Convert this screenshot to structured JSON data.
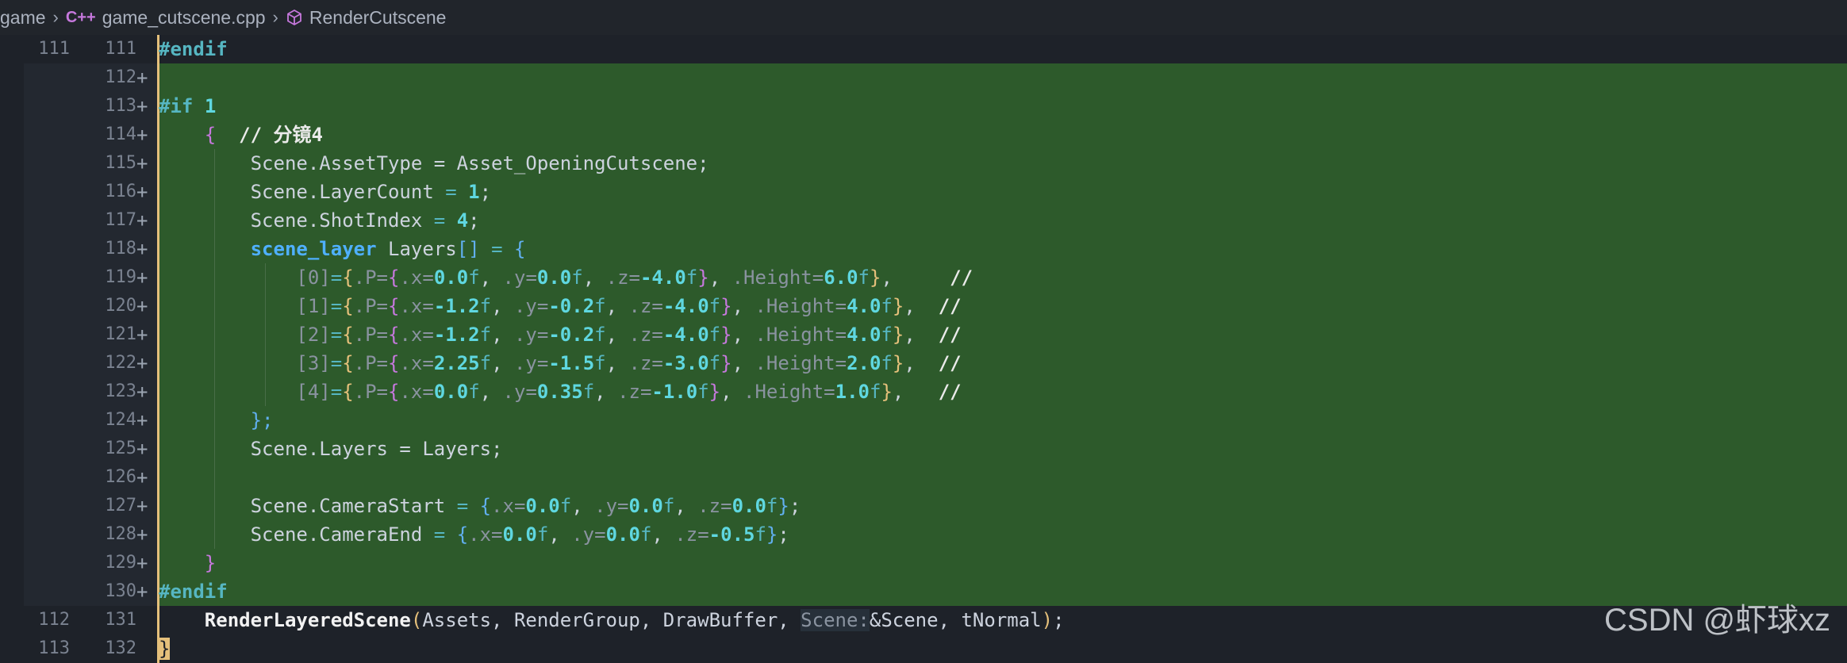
{
  "breadcrumb": {
    "folder": "game",
    "file": "game_cutscene.cpp",
    "symbol": "RenderCutscene",
    "file_icon_glyph": "C++"
  },
  "lines": {
    "l111": {
      "old": "111",
      "new": "111"
    },
    "l112": {
      "new": "112"
    },
    "l113": {
      "new": "113"
    },
    "l114": {
      "new": "114"
    },
    "l115": {
      "new": "115"
    },
    "l116": {
      "new": "116"
    },
    "l117": {
      "new": "117"
    },
    "l118": {
      "new": "118"
    },
    "l119": {
      "new": "119"
    },
    "l120": {
      "new": "120"
    },
    "l121": {
      "new": "121"
    },
    "l122": {
      "new": "122"
    },
    "l123": {
      "new": "123"
    },
    "l124": {
      "new": "124"
    },
    "l125": {
      "new": "125"
    },
    "l126": {
      "new": "126"
    },
    "l127": {
      "new": "127"
    },
    "l128": {
      "new": "128"
    },
    "l129": {
      "new": "129"
    },
    "l130": {
      "new": "130"
    },
    "l131": {
      "old": "112",
      "new": "131"
    },
    "l132": {
      "old": "113",
      "new": "132"
    }
  },
  "diff_marker": "+",
  "code": {
    "endif": "#endif",
    "if1_kw": "#if",
    "if1_val": "1",
    "l114_brace": "{",
    "l114_comment": "// 分镜4",
    "scene_asset": "Scene.AssetType = Asset_OpeningCutscene;",
    "scene_layercount": "Scene.LayerCount",
    "scene_shotindex": "Scene.ShotIndex",
    "layercount_val": "1",
    "shotindex_val": "4",
    "layers_type": "scene_layer",
    "layers_name": "Layers",
    "layers_close": "};",
    "scene_layers": "Scene.Layers = Layers;",
    "camera_start": "Scene.CameraStart",
    "camera_end": "Scene.CameraEnd",
    "close_brace": "}",
    "call_fn": "RenderLayeredScene",
    "call_args1": "Assets, RenderGroup, DrawBuffer, ",
    "call_hint": "Scene:",
    "call_args2": "&Scene, tNormal",
    "last_brace": "}"
  },
  "layers": [
    {
      "idx": "[0]",
      "x": "0.0",
      "y": "0.0",
      "z": "-4.0",
      "h": "6.0",
      "comment": "//"
    },
    {
      "idx": "[1]",
      "x": "-1.2",
      "y": "-0.2",
      "z": "-4.0",
      "h": "4.0",
      "comment": "//"
    },
    {
      "idx": "[2]",
      "x": "-1.2",
      "y": "-0.2",
      "z": "-4.0",
      "h": "4.0",
      "comment": "//"
    },
    {
      "idx": "[3]",
      "x": "2.25",
      "y": "-1.5",
      "z": "-3.0",
      "h": "2.0",
      "comment": "//"
    },
    {
      "idx": "[4]",
      "x": "0.0",
      "y": "0.35",
      "z": "-1.0",
      "h": "1.0",
      "comment": "//"
    }
  ],
  "camera_start_vals": {
    "x": "0.0",
    "y": "0.0",
    "z": "0.0"
  },
  "camera_end_vals": {
    "x": "0.0",
    "y": "0.0",
    "z": "-0.5"
  },
  "watermark": "CSDN @虾球xz",
  "colors": {
    "added_line_bg": "#2d5a2b",
    "editor_bg": "#1e2229",
    "gutter_marker": "#e5c07b"
  }
}
